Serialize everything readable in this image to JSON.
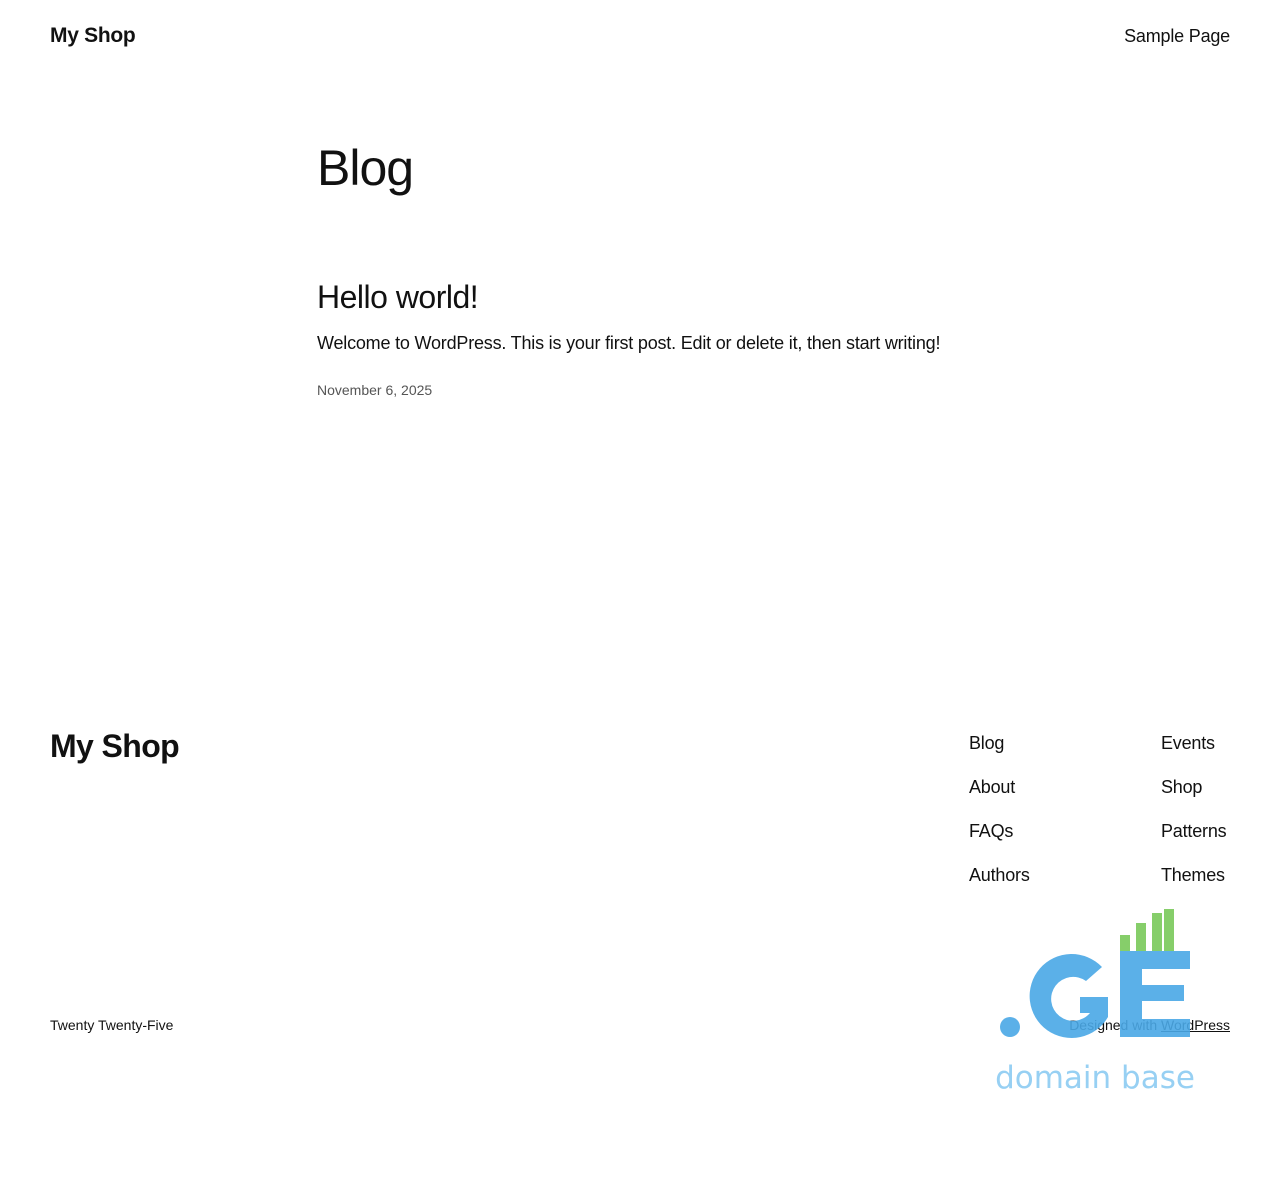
{
  "header": {
    "site_title": "My Shop",
    "nav": [
      "Sample Page"
    ]
  },
  "main": {
    "heading": "Blog",
    "posts": [
      {
        "title": "Hello world!",
        "excerpt": "Welcome to WordPress. This is your first post. Edit or delete it, then start writing!",
        "date": "November 6, 2025"
      }
    ]
  },
  "footer": {
    "site_title": "My Shop",
    "nav_col1": [
      "Blog",
      "About",
      "FAQs",
      "Authors"
    ],
    "nav_col2": [
      "Events",
      "Shop",
      "Patterns",
      "Themes"
    ],
    "theme_credit": "Twenty Twenty-Five",
    "designed_with_prefix": "Designed with ",
    "designed_with_link": "WordPress"
  },
  "watermark": {
    "logo_text": ".GE",
    "tagline": "domain base",
    "colors": {
      "blue": "#4aa8e6",
      "green": "#79c95a",
      "light_blue": "#8ccbf2"
    }
  }
}
